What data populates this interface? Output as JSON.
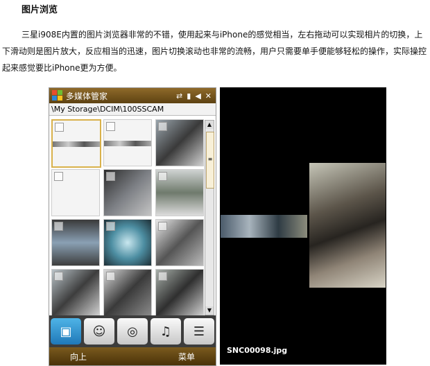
{
  "doc": {
    "heading": "图片浏览",
    "paragraph": "三星i908E内置的图片浏览器非常的不错，使用起来与iPhone的感觉相当，左右拖动可以实现相片的切换，上下滑动则是图片放大，反应相当的迅速，图片切换滚动也非常的流畅，用户只需要单手便能够轻松的操作，实际操控起来感觉要比iPhone更为方便。"
  },
  "phone": {
    "title": "多媒体管家",
    "status_icons": [
      "sync-icon",
      "signal-icon",
      "speaker-icon",
      "close-icon"
    ],
    "close_glyph": "✕",
    "path": "\\My Storage\\DCIM\\100SSCAM",
    "tabs": [
      {
        "name": "photo-video",
        "glyph": "▣"
      },
      {
        "name": "contacts",
        "glyph": "☺"
      },
      {
        "name": "video-reel",
        "glyph": "◎"
      },
      {
        "name": "music",
        "glyph": "♫"
      },
      {
        "name": "list",
        "glyph": "☰"
      }
    ],
    "softkey_left": "向上",
    "softkey_right": "菜单"
  },
  "viewer": {
    "filename": "SNC00098.jpg"
  }
}
